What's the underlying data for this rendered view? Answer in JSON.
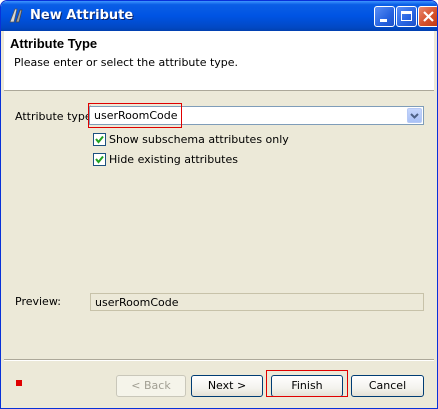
{
  "window": {
    "title": "New Attribute",
    "controls": [
      "minimize-icon",
      "maximize-icon",
      "close-icon"
    ]
  },
  "header": {
    "title": "Attribute Type",
    "description": "Please enter or select the attribute type."
  },
  "form": {
    "attribute_type_label": "Attribute type:",
    "attribute_type_value": "userRoomCode",
    "show_subschema_label": "Show subschema attributes only",
    "show_subschema_checked": true,
    "hide_existing_label": "Hide existing attributes",
    "hide_existing_checked": true,
    "preview_label": "Preview:",
    "preview_value": "userRoomCode"
  },
  "buttons": {
    "back_label": "< Back",
    "next_label": "Next >",
    "finish_label": "Finish",
    "cancel_label": "Cancel"
  },
  "colors": {
    "titlebar": "#0054e3",
    "highlight": "#e00000",
    "dialog_bg": "#ece9d8"
  }
}
